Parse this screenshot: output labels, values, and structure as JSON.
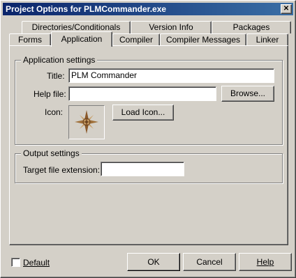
{
  "window": {
    "title": "Project Options for PLMCommander.exe",
    "close_glyph": "✕"
  },
  "tabs": {
    "back_row": [
      {
        "label": "Directories/Conditionals"
      },
      {
        "label": "Version Info"
      },
      {
        "label": "Packages"
      }
    ],
    "front_row": [
      {
        "label": "Forms"
      },
      {
        "label": "Application",
        "active": true
      },
      {
        "label": "Compiler"
      },
      {
        "label": "Compiler Messages"
      },
      {
        "label": "Linker"
      }
    ]
  },
  "application_settings": {
    "group_label": "Application settings",
    "title_label": "Title:",
    "title_value": "PLM Commander",
    "help_file_label": "Help file:",
    "help_file_value": "",
    "browse_label": "Browse...",
    "icon_label": "Icon:",
    "icon_name": "compass-rose-icon",
    "load_icon_label": "Load Icon..."
  },
  "output_settings": {
    "group_label": "Output settings",
    "target_ext_label": "Target file extension:",
    "target_ext_value": ""
  },
  "footer": {
    "default_label": "Default",
    "default_checked": false,
    "ok_label": "OK",
    "cancel_label": "Cancel",
    "help_label": "Help"
  }
}
